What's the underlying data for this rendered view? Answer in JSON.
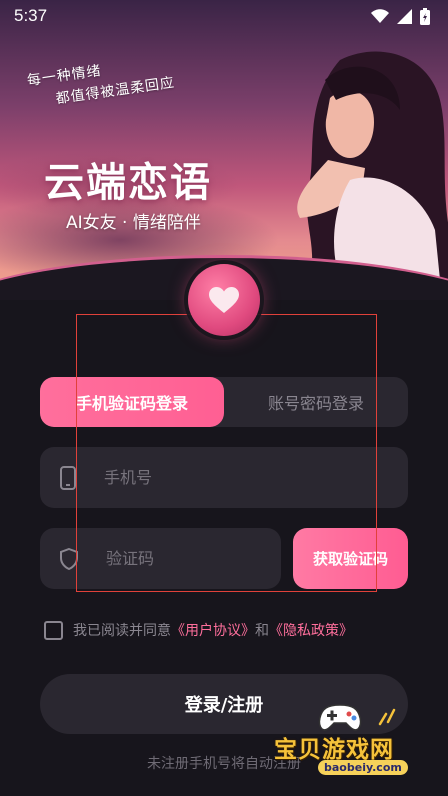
{
  "status_bar": {
    "time": "5:37"
  },
  "hero": {
    "slogan_line1": "每一种情绪",
    "slogan_line2": "都值得被温柔回应",
    "title": "云端恋语",
    "subtitle": "AI女友 · 情绪陪伴"
  },
  "tabs": [
    {
      "label": "手机验证码登录",
      "active": true
    },
    {
      "label": "账号密码登录",
      "active": false
    }
  ],
  "phone_field": {
    "placeholder": "手机号",
    "value": ""
  },
  "code_field": {
    "placeholder": "验证码",
    "value": ""
  },
  "get_code_label": "获取验证码",
  "agreement": {
    "prefix": "我已阅读并同意",
    "user_agreement": "《用户协议》",
    "and": "和",
    "privacy_policy": "《隐私政策》",
    "checked": false
  },
  "login_label": "登录/注册",
  "footnote": "未注册手机号将自动注册",
  "watermark": {
    "text": "宝贝游戏网",
    "url": "baobeiy.com"
  },
  "colors": {
    "accent": "#ff6f9c",
    "background": "#17151c",
    "field": "#2a2730"
  },
  "icons": [
    "wifi-icon",
    "signal-icon",
    "battery-icon",
    "heart-icon",
    "phone-icon",
    "shield-icon"
  ]
}
